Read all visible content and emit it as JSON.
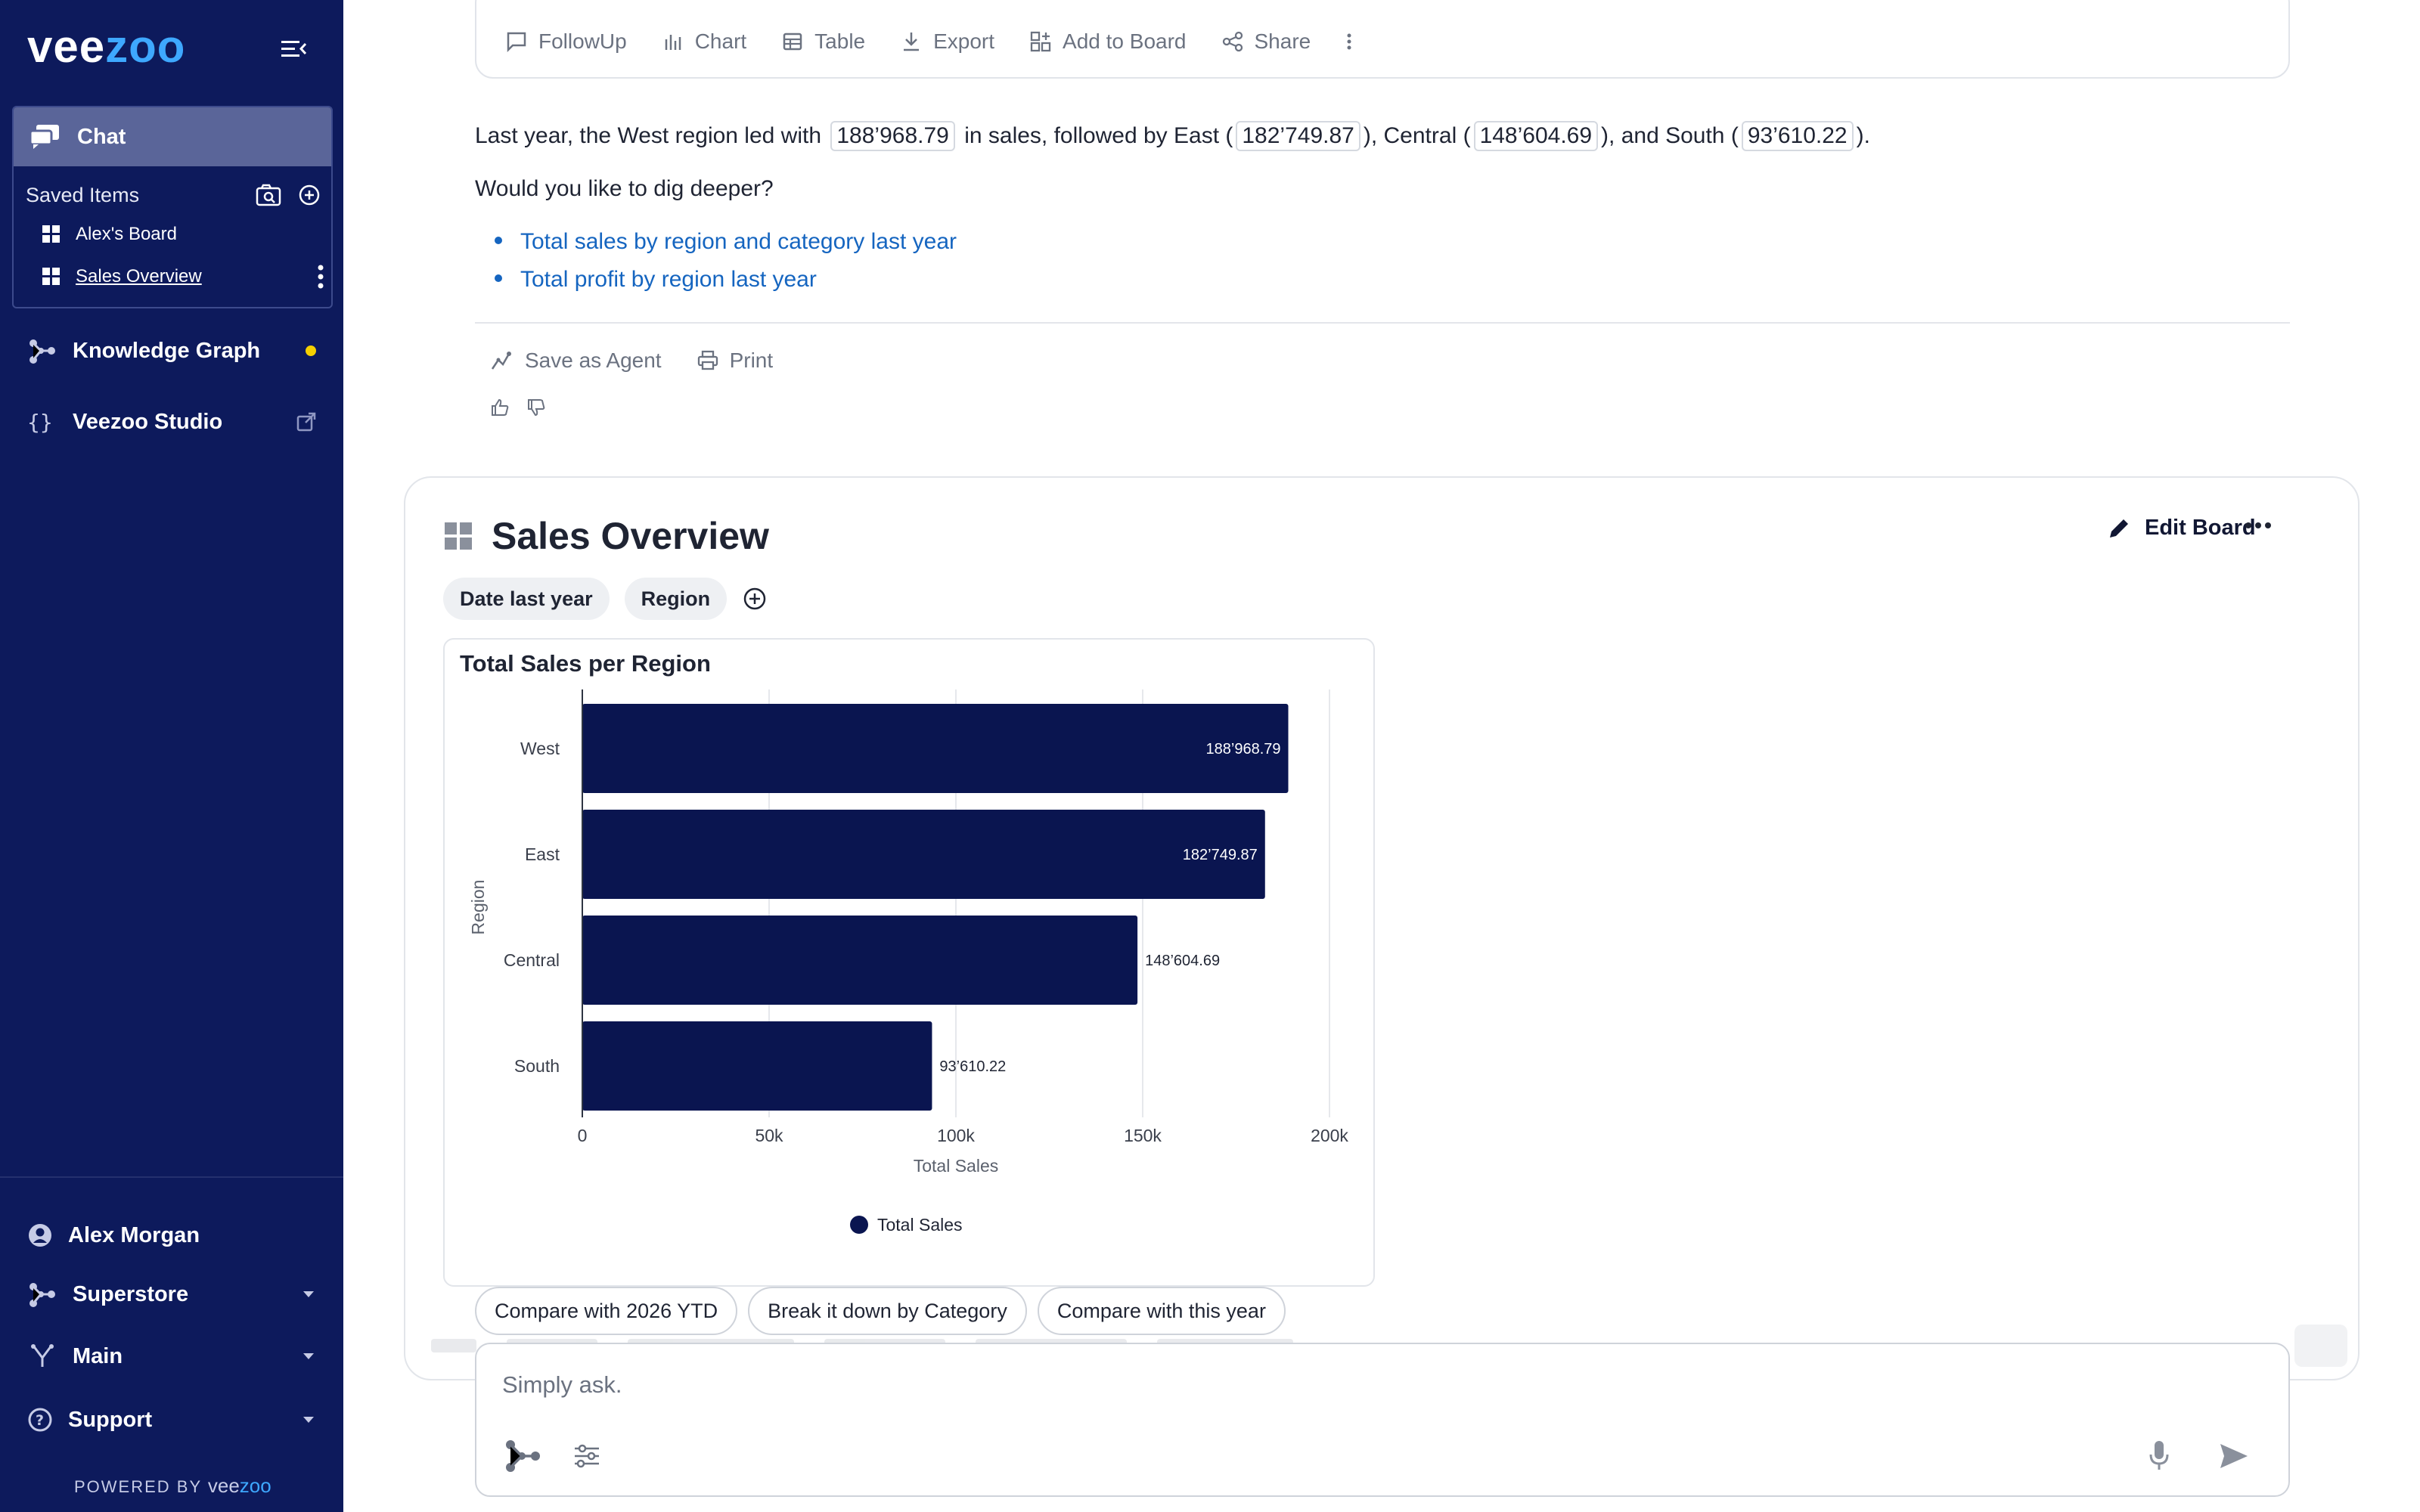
{
  "sidebar": {
    "logo": {
      "main": "vee",
      "accent": "zoo"
    },
    "chat_label": "Chat",
    "saved_items_label": "Saved Items",
    "saved_items": [
      {
        "label": "Alex's Board"
      },
      {
        "label": "Sales Overview"
      }
    ],
    "nav": [
      {
        "label": "Knowledge Graph",
        "icon": "knowledge-graph-icon"
      },
      {
        "label": "Veezoo Studio",
        "icon": "braces-icon"
      }
    ],
    "bottom_nav": [
      {
        "label": "Alex Morgan",
        "icon": "user-circle-icon"
      },
      {
        "label": "Superstore",
        "icon": "knowledge-graph-icon"
      },
      {
        "label": "Main",
        "icon": "branch-icon"
      },
      {
        "label": "Support",
        "icon": "help-circle-icon"
      }
    ],
    "powered_by": "POWERED BY",
    "powered_brand_main": "vee",
    "powered_brand_accent": "zoo"
  },
  "toolbar": {
    "buttons": [
      {
        "label": "FollowUp"
      },
      {
        "label": "Chart"
      },
      {
        "label": "Table"
      },
      {
        "label": "Export"
      },
      {
        "label": "Add to Board"
      },
      {
        "label": "Share"
      }
    ]
  },
  "answer": {
    "p1": "Last year, the West region led with",
    "v_west": "188’968.79",
    "p2": "in sales, followed by East (",
    "v_east": "182’749.87",
    "p3": "), Central (",
    "v_central": "148’604.69",
    "p4": "), and South (",
    "v_south": "93’610.22",
    "p5": ").",
    "question": "Would you like to dig deeper?",
    "suggestions": [
      "Total sales by region and category last year",
      "Total profit by region last year"
    ],
    "save_agent": "Save as Agent",
    "print": "Print"
  },
  "board": {
    "title": "Sales Overview",
    "edit_label": "Edit Board",
    "filters": [
      "Date last year",
      "Region"
    ]
  },
  "chart_data": {
    "type": "bar",
    "orientation": "horizontal",
    "title": "Total Sales per Region",
    "xlabel": "Total Sales",
    "ylabel": "Region",
    "categories": [
      "West",
      "East",
      "Central",
      "South"
    ],
    "series": [
      {
        "name": "Total Sales",
        "values": [
          188968.79,
          182749.87,
          148604.69,
          93610.22
        ]
      }
    ],
    "value_labels": [
      "188’968.79",
      "182’749.87",
      "148’604.69",
      "93’610.22"
    ],
    "xlim": [
      0,
      200000
    ],
    "xticks": [
      0,
      50000,
      100000,
      150000,
      200000
    ],
    "xtick_labels": [
      "0",
      "50k",
      "100k",
      "150k",
      "200k"
    ],
    "legend": "bottom",
    "grid": true,
    "bar_color": "#0a1550"
  },
  "followups": [
    "Compare with 2026 YTD",
    "Break it down by Category",
    "Compare with this year"
  ],
  "input": {
    "placeholder": "Simply ask."
  },
  "colors": {
    "sidebar_bg": "#0d1a5c",
    "accent": "#3ea8ff",
    "link": "#1565c0"
  }
}
